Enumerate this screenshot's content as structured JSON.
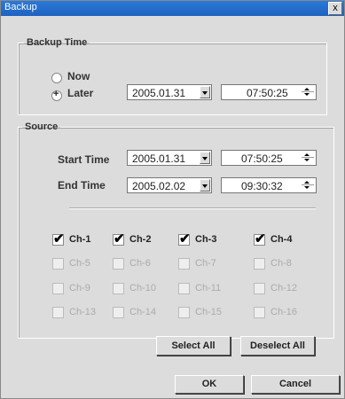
{
  "window": {
    "title": "Backup",
    "close": "x"
  },
  "backup_time": {
    "legend": "Backup Time",
    "now_label": "Now",
    "later_label": "Later",
    "date": "2005.01.31",
    "time": "07:50:25"
  },
  "source": {
    "legend": "Source",
    "start_label": "Start Time",
    "start_date": "2005.01.31",
    "start_time": "07:50:25",
    "end_label": "End Time",
    "end_date": "2005.02.02",
    "end_time": "09:30:32"
  },
  "channels": [
    {
      "label": "Ch-1",
      "checked": true,
      "enabled": true
    },
    {
      "label": "Ch-2",
      "checked": true,
      "enabled": true
    },
    {
      "label": "Ch-3",
      "checked": true,
      "enabled": true
    },
    {
      "label": "Ch-4",
      "checked": true,
      "enabled": true
    },
    {
      "label": "Ch-5",
      "checked": false,
      "enabled": false
    },
    {
      "label": "Ch-6",
      "checked": false,
      "enabled": false
    },
    {
      "label": "Ch-7",
      "checked": false,
      "enabled": false
    },
    {
      "label": "Ch-8",
      "checked": false,
      "enabled": false
    },
    {
      "label": "Ch-9",
      "checked": false,
      "enabled": false
    },
    {
      "label": "Ch-10",
      "checked": false,
      "enabled": false
    },
    {
      "label": "Ch-11",
      "checked": false,
      "enabled": false
    },
    {
      "label": "Ch-12",
      "checked": false,
      "enabled": false
    },
    {
      "label": "Ch-13",
      "checked": false,
      "enabled": false
    },
    {
      "label": "Ch-14",
      "checked": false,
      "enabled": false
    },
    {
      "label": "Ch-15",
      "checked": false,
      "enabled": false
    },
    {
      "label": "Ch-16",
      "checked": false,
      "enabled": false
    }
  ],
  "buttons": {
    "select_all": "Select All",
    "deselect_all": "Deselect All",
    "ok": "OK",
    "cancel": "Cancel"
  }
}
